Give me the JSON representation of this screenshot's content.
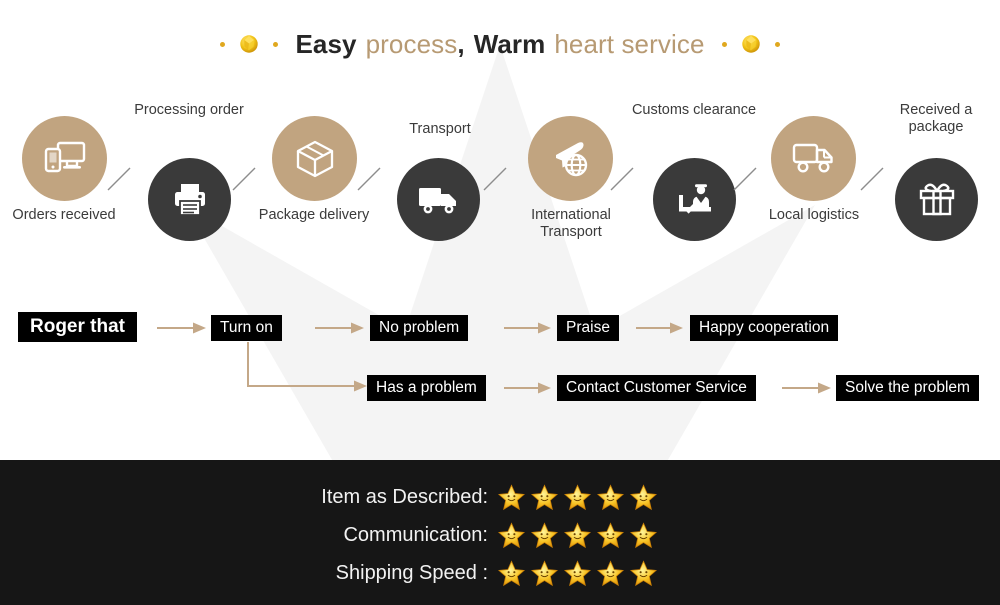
{
  "header": {
    "segments": [
      {
        "text": "Easy",
        "style": "dark"
      },
      {
        "text": "process",
        "style": "tan"
      },
      {
        "text": ",",
        "style": "comma"
      },
      {
        "text": "Warm",
        "style": "dark"
      },
      {
        "text": "heart service",
        "style": "tan"
      }
    ],
    "full_text": "Easy process, Warm heart service",
    "gem_icon": "gold-gem-icon",
    "dot_icon": "gold-dot-icon",
    "colors": {
      "dark": "#262626",
      "tan": "#b79a73",
      "gold": "#e0a81f"
    }
  },
  "process": {
    "colors": {
      "tan": "#c1a480",
      "dark": "#3a3a3a",
      "label": "#3b3b3b"
    },
    "steps": [
      {
        "label": "Orders received",
        "icon": "desktop-mobile-icon",
        "tone": "tan",
        "label_position": "below"
      },
      {
        "label": "Processing order",
        "icon": "printer-icon",
        "tone": "dark",
        "label_position": "above"
      },
      {
        "label": "Package delivery",
        "icon": "package-box-icon",
        "tone": "tan",
        "label_position": "below"
      },
      {
        "label": "Transport",
        "icon": "truck-icon",
        "tone": "dark",
        "label_position": "above"
      },
      {
        "label": "International Transport",
        "icon": "airplane-globe-icon",
        "tone": "tan",
        "label_position": "below"
      },
      {
        "label": "Customs clearance",
        "icon": "customs-officer-icon",
        "tone": "dark",
        "label_position": "above"
      },
      {
        "label": "Local logistics",
        "icon": "delivery-truck-outline-icon",
        "tone": "tan",
        "label_position": "below"
      },
      {
        "label": "Received a package",
        "icon": "gift-box-icon",
        "tone": "dark",
        "label_position": "above"
      }
    ]
  },
  "flow": {
    "arrow_color": "#c4a888",
    "chip_bg": "#000000",
    "chip_text": "#ffffff",
    "top_row": [
      "Roger that",
      "Turn on",
      "No problem",
      "Praise",
      "Happy cooperation"
    ],
    "bottom_row": [
      "Has a problem",
      "Contact Customer Service",
      "Solve the problem"
    ],
    "chips": {
      "roger_that": "Roger that",
      "turn_on": "Turn on",
      "no_problem": "No problem",
      "praise": "Praise",
      "happy_cooperation": "Happy cooperation",
      "has_a_problem": "Has a problem",
      "contact_customer_service": "Contact Customer Service",
      "solve_the_problem": "Solve the problem"
    }
  },
  "ratings": {
    "background": "#161616",
    "star_icon": "gold-smiley-star-icon",
    "rows": [
      {
        "label": "Item as Described:",
        "stars": 5,
        "max": 5
      },
      {
        "label": "Communication:",
        "stars": 5,
        "max": 5
      },
      {
        "label": "Shipping Speed :",
        "stars": 5,
        "max": 5
      }
    ]
  }
}
